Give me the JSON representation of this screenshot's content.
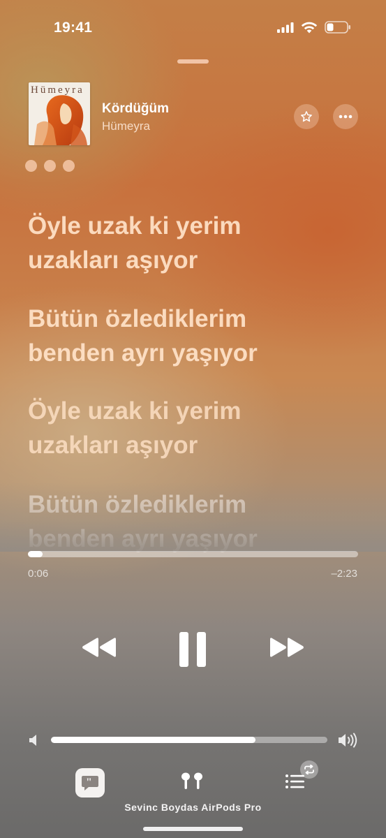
{
  "status_bar": {
    "time": "19:41"
  },
  "now_playing": {
    "title": "Kördüğüm",
    "artist": "Hümeyra",
    "album_art_text": "Hümeyra",
    "favorite_icon": "star-icon",
    "more_icon": "ellipsis-icon"
  },
  "lyrics": {
    "lines": [
      "Öyle uzak ki yerim",
      "uzakları aşıyor",
      "Bütün özlediklerim",
      "benden ayrı yaşıyor",
      "Öyle uzak ki yerim",
      "uzakları aşıyor",
      "Bütün özlediklerim",
      "benden ayrı yaşıyor"
    ]
  },
  "playback": {
    "elapsed": "0:06",
    "remaining": "–2:23",
    "progress_fraction": 0.045,
    "volume_fraction": 0.74
  },
  "controls": {
    "rewind_icon": "rewind-icon",
    "pause_icon": "pause-icon",
    "forward_icon": "fast-forward-icon"
  },
  "bottom_bar": {
    "device_name": "Sevinc Boydas AirPods Pro"
  },
  "colors": {
    "accent_orange": "#c8713d",
    "text_lyric": "#ffe2c8"
  }
}
